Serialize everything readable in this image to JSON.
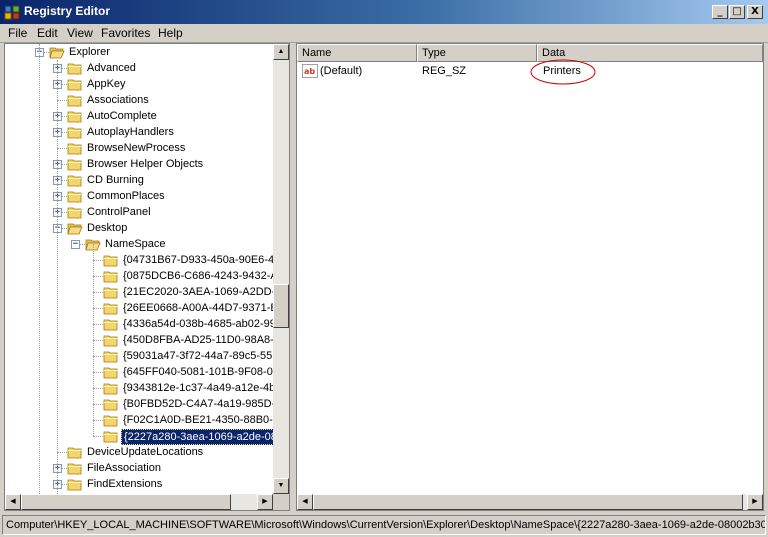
{
  "window": {
    "title": "Registry Editor",
    "buttons": {
      "minimize": "_",
      "maximize": "□",
      "close": "X"
    }
  },
  "menu": [
    "File",
    "Edit",
    "View",
    "Favorites",
    "Help"
  ],
  "tree": {
    "items": [
      {
        "label": "Explorer",
        "depth": 0,
        "expander": "minus"
      },
      {
        "label": "Advanced",
        "depth": 1,
        "expander": "plus"
      },
      {
        "label": "AppKey",
        "depth": 1,
        "expander": "plus"
      },
      {
        "label": "Associations",
        "depth": 1,
        "expander": "none"
      },
      {
        "label": "AutoComplete",
        "depth": 1,
        "expander": "plus"
      },
      {
        "label": "AutoplayHandlers",
        "depth": 1,
        "expander": "plus"
      },
      {
        "label": "BrowseNewProcess",
        "depth": 1,
        "expander": "none"
      },
      {
        "label": "Browser Helper Objects",
        "depth": 1,
        "expander": "plus"
      },
      {
        "label": "CD Burning",
        "depth": 1,
        "expander": "plus"
      },
      {
        "label": "CommonPlaces",
        "depth": 1,
        "expander": "plus"
      },
      {
        "label": "ControlPanel",
        "depth": 1,
        "expander": "plus"
      },
      {
        "label": "Desktop",
        "depth": 1,
        "expander": "minus"
      },
      {
        "label": "NameSpace",
        "depth": 2,
        "expander": "minus"
      },
      {
        "label": "{04731B67-D933-450a-90E6-4A",
        "depth": 3,
        "expander": "none"
      },
      {
        "label": "{0875DCB6-C686-4243-9432-A",
        "depth": 3,
        "expander": "none"
      },
      {
        "label": "{21EC2020-3AEA-1069-A2DD-0",
        "depth": 3,
        "expander": "none"
      },
      {
        "label": "{26EE0668-A00A-44D7-9371-B",
        "depth": 3,
        "expander": "none"
      },
      {
        "label": "{4336a54d-038b-4685-ab02-99",
        "depth": 3,
        "expander": "none"
      },
      {
        "label": "{450D8FBA-AD25-11D0-98A8-0",
        "depth": 3,
        "expander": "none"
      },
      {
        "label": "{59031a47-3f72-44a7-89c5-55",
        "depth": 3,
        "expander": "none"
      },
      {
        "label": "{645FF040-5081-101B-9F08-00",
        "depth": 3,
        "expander": "none"
      },
      {
        "label": "{9343812e-1c37-4a49-a12e-4b",
        "depth": 3,
        "expander": "none"
      },
      {
        "label": "{B0FBD52D-C4A7-4a19-985D-1",
        "depth": 3,
        "expander": "none"
      },
      {
        "label": "{F02C1A0D-BE21-4350-88B0-7",
        "depth": 3,
        "expander": "none"
      },
      {
        "label": "{2227a280-3aea-1069-a2de-08",
        "depth": 3,
        "expander": "none",
        "selected": true
      },
      {
        "label": "DeviceUpdateLocations",
        "depth": 1,
        "expander": "none"
      },
      {
        "label": "FileAssociation",
        "depth": 1,
        "expander": "plus"
      },
      {
        "label": "FindExtensions",
        "depth": 1,
        "expander": "plus"
      }
    ]
  },
  "list": {
    "columns": [
      "Name",
      "Type",
      "Data"
    ],
    "rows": [
      {
        "name": "(Default)",
        "type": "REG_SZ",
        "data": "Printers",
        "icon": "string-value-icon"
      }
    ]
  },
  "status": "Computer\\HKEY_LOCAL_MACHINE\\SOFTWARE\\Microsoft\\Windows\\CurrentVersion\\Explorer\\Desktop\\NameSpace\\{2227a280-3aea-1069-a2de-08002b303",
  "colors": {
    "title_start": "#0a246a",
    "title_end": "#a6caf0",
    "selection": "#0a246a",
    "annotation": "#cc0000"
  }
}
